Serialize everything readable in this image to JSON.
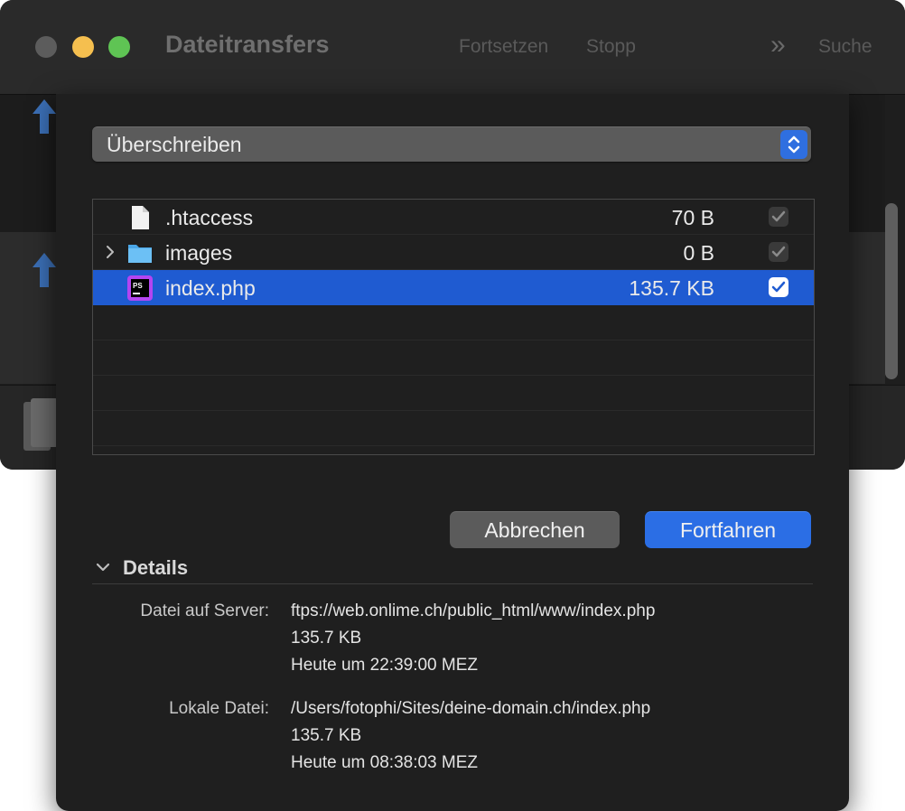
{
  "window": {
    "title": "Dateitransfers",
    "toolbar": {
      "resume": "Fortsetzen",
      "stop": "Stopp",
      "search": "Suche"
    }
  },
  "sheet": {
    "action_popup": "Überschreiben",
    "files": [
      {
        "name": ".htaccess",
        "size": "70 B",
        "checked": true,
        "icon": "document-icon"
      },
      {
        "name": "images",
        "size": "0 B",
        "checked": true,
        "icon": "folder-icon"
      },
      {
        "name": "index.php",
        "size": "135.7 KB",
        "checked": true,
        "icon": "phpstorm-icon",
        "selected": true
      }
    ],
    "buttons": {
      "cancel": "Abbrechen",
      "continue": "Fortfahren"
    },
    "details": {
      "title": "Details",
      "server_label": "Datei auf Server:",
      "server_path": "ftps://web.onlime.ch/public_html/www/index.php",
      "server_size": "135.7 KB",
      "server_date": "Heute um 22:39:00 MEZ",
      "local_label": "Lokale Datei:",
      "local_path": "/Users/fotophi/Sites/deine-domain.ch/index.php",
      "local_size": "135.7 KB",
      "local_date": "Heute um 08:38:03 MEZ"
    }
  },
  "colors": {
    "accent": "#2b6ee5",
    "selection": "#1f5bd1"
  }
}
